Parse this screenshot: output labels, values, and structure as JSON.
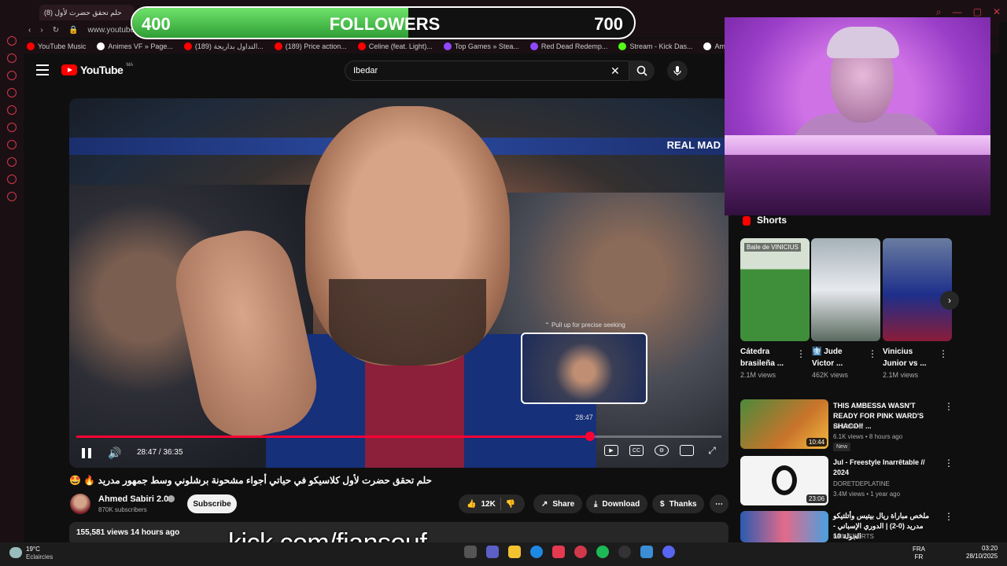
{
  "browser": {
    "tab_title": "(8) حلم تحقق حضرت لأول",
    "url": "www.youtube.",
    "bookmarks": [
      {
        "label": "YouTube Music",
        "color": "#ff0000"
      },
      {
        "label": "Animes VF » Page...",
        "color": "#ffffff"
      },
      {
        "label": "(189) التداول بداريجة...",
        "color": "#ff0000"
      },
      {
        "label": "(189) Price action...",
        "color": "#ff0000"
      },
      {
        "label": "Celine (feat. Light)...",
        "color": "#ff0000"
      },
      {
        "label": "Top Games » Stea...",
        "color": "#9146ff"
      },
      {
        "label": "Red Dead Redemp...",
        "color": "#9146ff"
      },
      {
        "label": "Stream - Kick Das...",
        "color": "#53fc18"
      },
      {
        "label": "Amazon.com: Cas...",
        "color": "#ffffff"
      }
    ]
  },
  "youtube": {
    "logo": "YouTube",
    "region": "MA",
    "search_value": "Ibedar"
  },
  "overlay": {
    "followers_min": "400",
    "followers_label": "FOLLOWERS",
    "followers_max": "700",
    "followers_progress": 0.55,
    "kick_url": "kick.com/fiansouf"
  },
  "player": {
    "stadium_text": "REAL MAD",
    "seek_hint": "Pull up for precise seeking",
    "preview_time": "28:47",
    "time_readout": "28:47 / 36:35",
    "progress": 0.796
  },
  "video": {
    "title": "حلم تحقق حضرت لأول كلاسيكو في حياتي أجواء مشحونة برشلوني وسط جمهور مدريد 🔥 🤩",
    "channel": "Ahmed Sabiri 2.0",
    "subscribers": "870K subscribers",
    "subscribe_label": "Subscribe",
    "likes": "12K",
    "share_label": "Share",
    "download_label": "Download",
    "thanks_label": "Thanks",
    "views": "155,581 views",
    "age": "14 hours ago"
  },
  "shorts": {
    "heading": "Shorts",
    "items": [
      {
        "title": "Cátedra brasileña ...",
        "views": "2.1M views",
        "caption": "Baile de VINICIUS"
      },
      {
        "title": "🩻 Jude Victor ...",
        "views": "462K views"
      },
      {
        "title": "Vinicius Junior vs ...",
        "views": "2.1M views"
      }
    ]
  },
  "recommendations": [
    {
      "title": "THIS AMBESSA WASN'T READY FOR PINK WARD'S SHACO!! ...",
      "channel": "Pink Ward",
      "meta": "6.1K views • 8 hours ago",
      "badge": "New",
      "duration": "10:44"
    },
    {
      "title": "Jul - Freestyle Inarrêtable // 2024",
      "channel": "DORETDEPLATINE",
      "meta": "3.4M views • 1 year ago",
      "duration": "23:06"
    },
    {
      "title": "ملخص مباراة ريال بيتيس وأتلتيكو مدريد (0-2) | الدوري الإسباني - الجولة 10",
      "channel": "beIN SPORTS",
      "meta": ""
    }
  ],
  "taskbar": {
    "temp": "19°C",
    "weather": "Eclaircies",
    "lang_top": "FRA",
    "lang_bottom": "FR",
    "time": "03:20",
    "date": "28/10/2025"
  },
  "colors": {
    "accent": "#ff0033",
    "followers_fill": "#4cc24a",
    "webcam": "#b44fe0"
  }
}
